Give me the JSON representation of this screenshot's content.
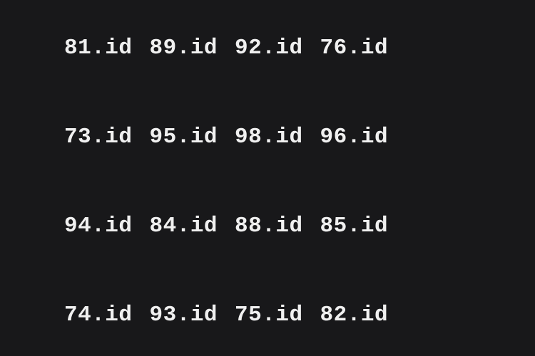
{
  "rows": [
    {
      "items": [
        "81.id",
        "89.id",
        "92.id",
        "76.id"
      ]
    },
    {
      "items": [
        "73.id",
        "95.id",
        "98.id",
        "96.id"
      ]
    },
    {
      "items": [
        "94.id",
        "84.id",
        "88.id",
        "85.id"
      ]
    },
    {
      "items": [
        "74.id",
        "93.id",
        "75.id",
        "82.id"
      ]
    }
  ]
}
